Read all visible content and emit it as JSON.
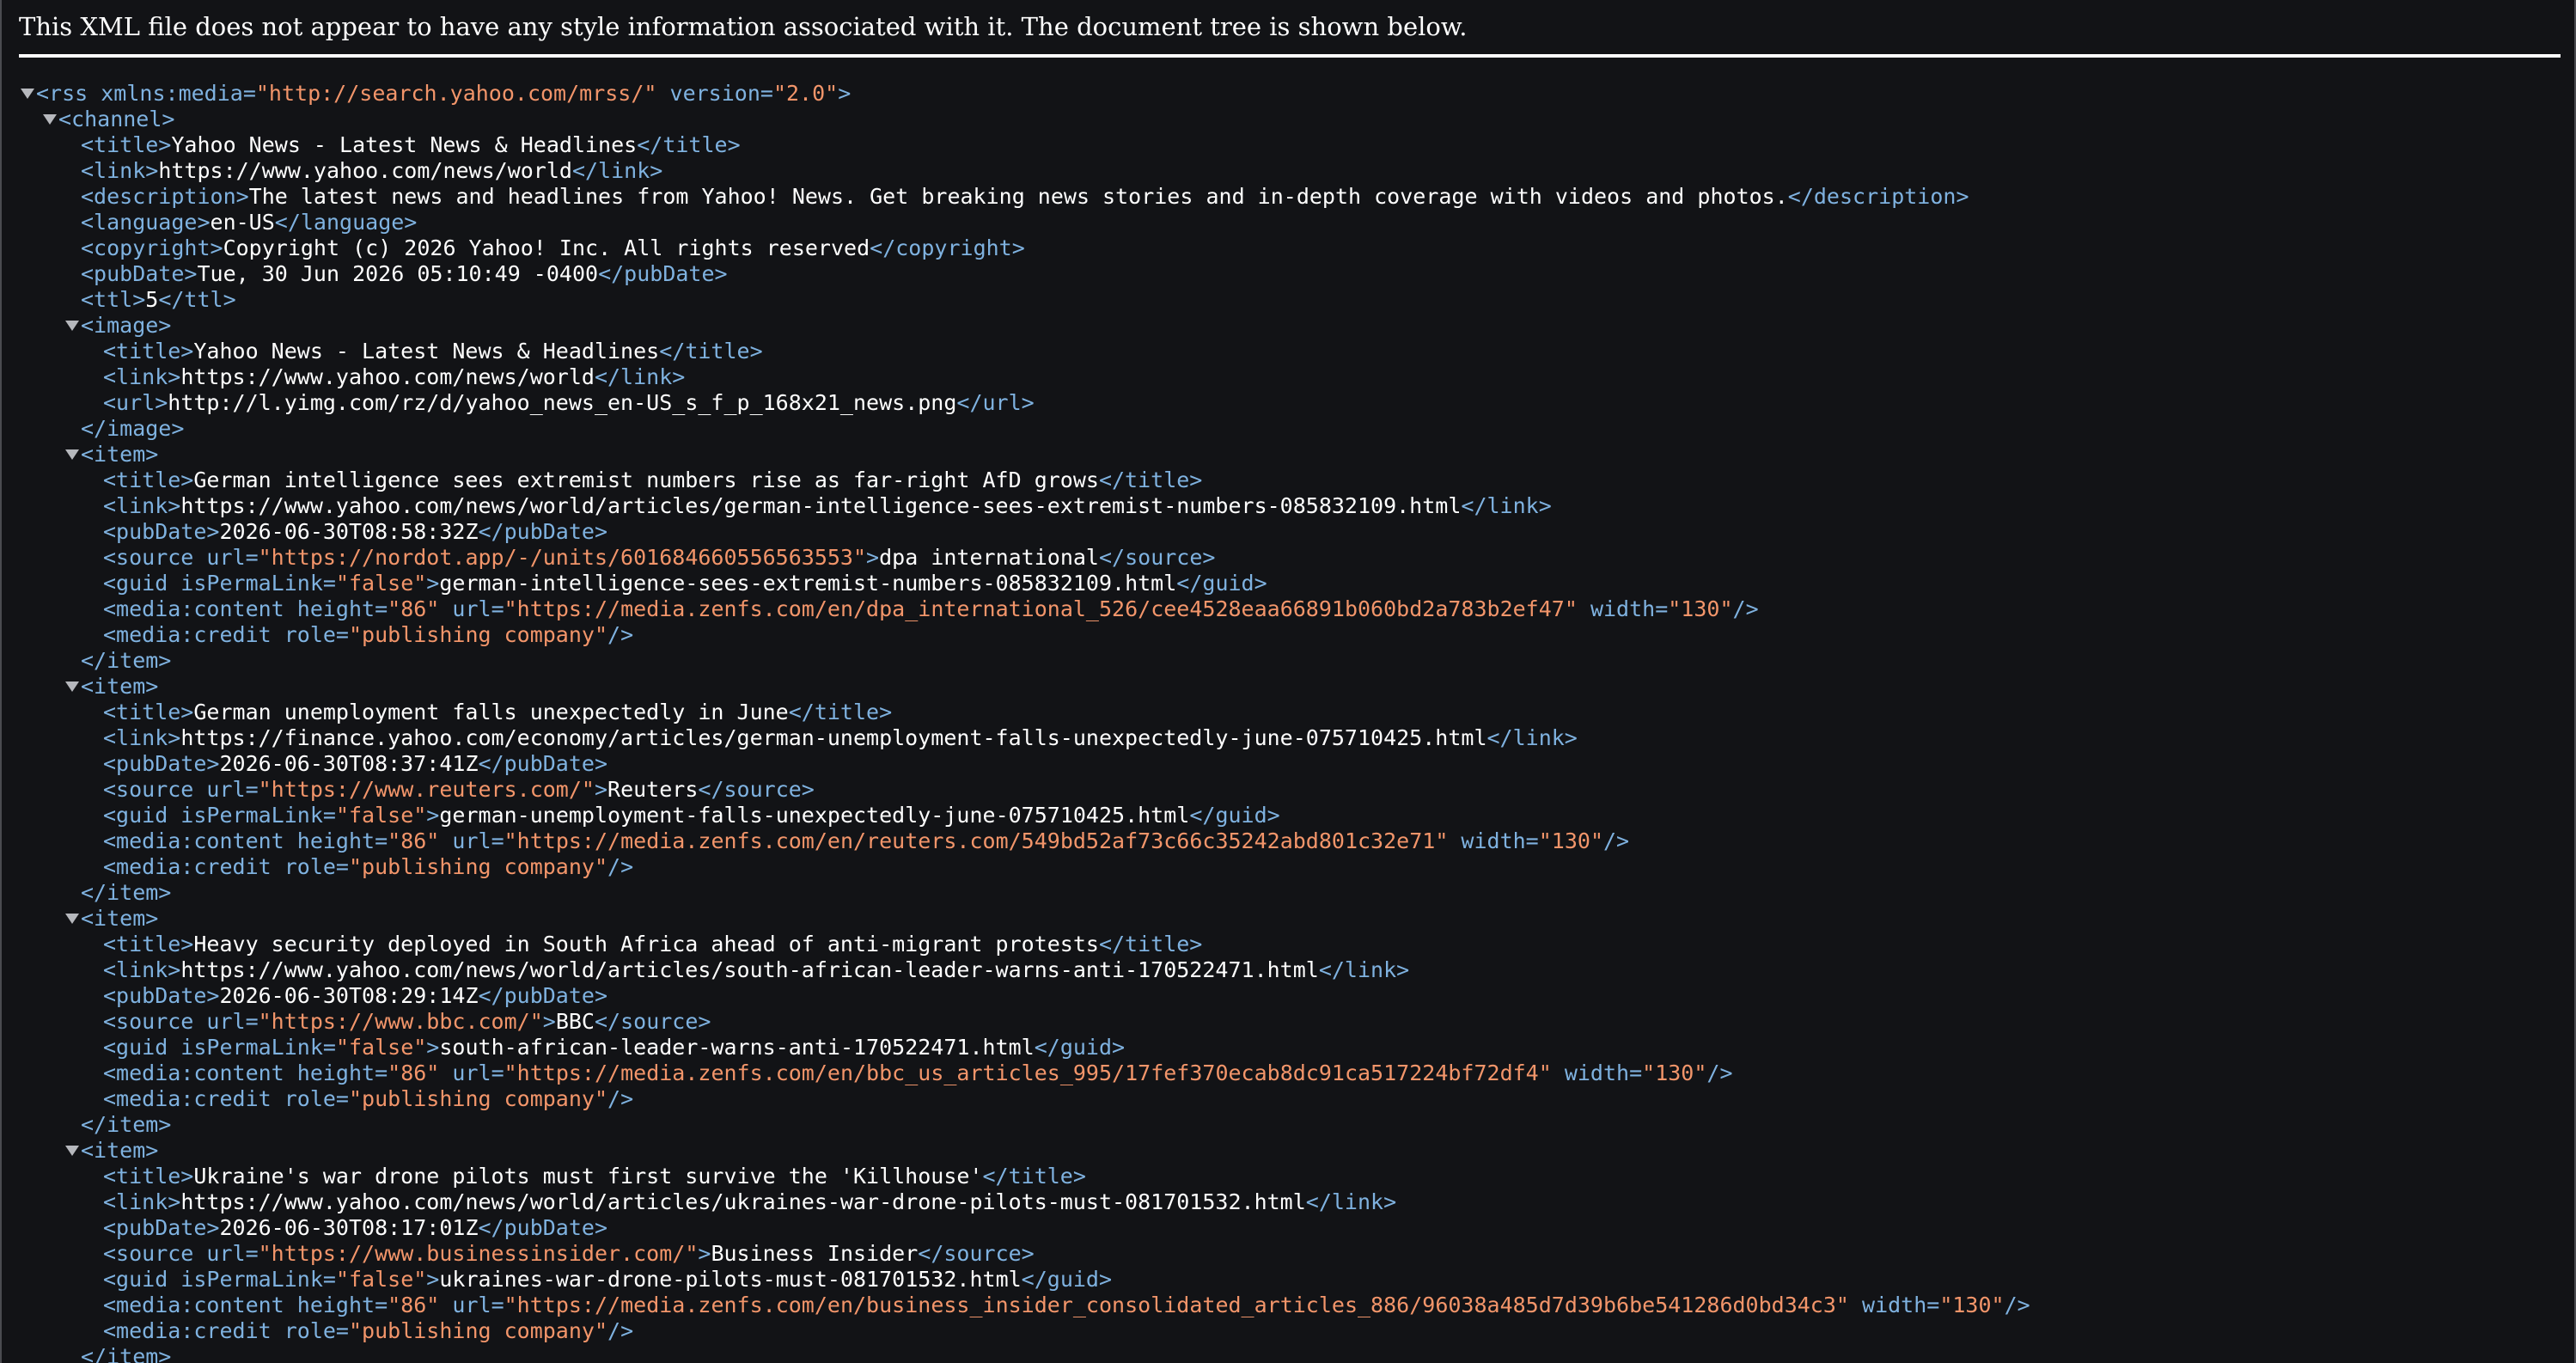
{
  "header": {
    "notice": "This XML file does not appear to have any style information associated with it. The document tree is shown below."
  },
  "rss": {
    "open": "<rss xmlns:media=\"http://search.yahoo.com/mrss/\" version=\"2.0\">",
    "xmlns_media": "http://search.yahoo.com/mrss/",
    "version": "2.0"
  },
  "channel": {
    "title": "Yahoo News - Latest News & Headlines",
    "link": "https://www.yahoo.com/news/world",
    "description": "The latest news and headlines from Yahoo! News. Get breaking news stories and in-depth coverage with videos and photos.",
    "language": "en-US",
    "copyright": "Copyright (c) 2026 Yahoo! Inc. All rights reserved",
    "pubDate": "Tue, 30 Jun 2026 05:10:49 -0400",
    "ttl": "5",
    "image": {
      "title": "Yahoo News - Latest News & Headlines",
      "link": "https://www.yahoo.com/news/world",
      "url": "http://l.yimg.com/rz/d/yahoo_news_en-US_s_f_p_168x21_news.png"
    },
    "items": [
      {
        "title": "German intelligence sees extremist numbers rise as far-right AfD grows",
        "link": "https://www.yahoo.com/news/world/articles/german-intelligence-sees-extremist-numbers-085832109.html",
        "pubDate": "2026-06-30T08:58:32Z",
        "source_url": "https://nordot.app/-/units/601684660556563553",
        "source": "dpa international",
        "guid_permalink": "false",
        "guid": "german-intelligence-sees-extremist-numbers-085832109.html",
        "media_height": "86",
        "media_url": "https://media.zenfs.com/en/dpa_international_526/cee4528eaa66891b060bd2a783b2ef47",
        "media_width": "130",
        "credit_role": "publishing company"
      },
      {
        "title": "German unemployment falls unexpectedly in June",
        "link": "https://finance.yahoo.com/economy/articles/german-unemployment-falls-unexpectedly-june-075710425.html",
        "pubDate": "2026-06-30T08:37:41Z",
        "source_url": "https://www.reuters.com/",
        "source": "Reuters",
        "guid_permalink": "false",
        "guid": "german-unemployment-falls-unexpectedly-june-075710425.html",
        "media_height": "86",
        "media_url": "https://media.zenfs.com/en/reuters.com/549bd52af73c66c35242abd801c32e71",
        "media_width": "130",
        "credit_role": "publishing company"
      },
      {
        "title": "Heavy security deployed in South Africa ahead of anti-migrant protests",
        "link": "https://www.yahoo.com/news/world/articles/south-african-leader-warns-anti-170522471.html",
        "pubDate": "2026-06-30T08:29:14Z",
        "source_url": "https://www.bbc.com/",
        "source": "BBC",
        "guid_permalink": "false",
        "guid": "south-african-leader-warns-anti-170522471.html",
        "media_height": "86",
        "media_url": "https://media.zenfs.com/en/bbc_us_articles_995/17fef370ecab8dc91ca517224bf72df4",
        "media_width": "130",
        "credit_role": "publishing company"
      },
      {
        "title": "Ukraine's war drone pilots must first survive the 'Killhouse'",
        "link": "https://www.yahoo.com/news/world/articles/ukraines-war-drone-pilots-must-081701532.html",
        "pubDate": "2026-06-30T08:17:01Z",
        "source_url": "https://www.businessinsider.com/",
        "source": "Business Insider",
        "guid_permalink": "false",
        "guid": "ukraines-war-drone-pilots-must-081701532.html",
        "media_height": "86",
        "media_url": "https://media.zenfs.com/en/business_insider_consolidated_articles_886/96038a485d7d39b6be541286d0bd34c3",
        "media_width": "130",
        "credit_role": "publishing company"
      }
    ]
  },
  "colors": {
    "background": "#121316",
    "tag": "#7fb2e0",
    "text": "#ffffff",
    "attribute_value": "#f2956a"
  }
}
